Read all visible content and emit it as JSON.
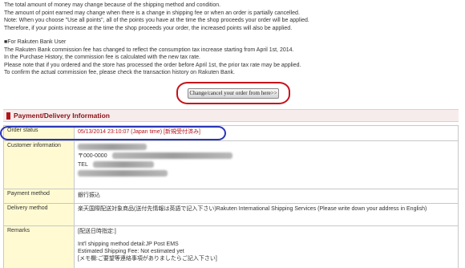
{
  "notices": {
    "line1": "The total amount of money may change because of the shipping method and condition.",
    "line2": "The amount of point earned may change when there is a change in shipping fee or when an order is partially cancelled.",
    "line3": "Note: When you choose \"Use all points\", all of the points you have at the time the shop proceeds your order will be applied.",
    "line4": "Therefore, if your points increase at the time the shop proceeds your order, the increased points will also be applied.",
    "bank_heading": "■For Rakuten Bank User",
    "bank_line1": "The Rakuten Bank commission fee has changed to reflect the consumption tax increase starting from April 1st, 2014.",
    "bank_line2": "In the Purchase History, the commission fee is calculated with the new tax rate.",
    "bank_line3": "Please note that if you ordered and the store has processed the order before April 1st, the prior tax rate may be applied.",
    "bank_line4": "To confirm the actual commission fee, please check the transaction history on Rakuten Bank."
  },
  "change_button_label": "Change/cancel your order from here>>",
  "section": {
    "title": "Payment/Delivery Information"
  },
  "rows": {
    "order_status": {
      "label": "Order status",
      "value": "05/13/2014 23:10:07 (Japan time) [新規受付済み]"
    },
    "customer_information": {
      "label": "Customer information",
      "postal_prefix": "〒000-0000",
      "tel_prefix": "TEL"
    },
    "payment_method": {
      "label": "Payment method",
      "value": "銀行振込"
    },
    "delivery_method": {
      "label": "Delivery method",
      "value": "楽天国際配送対象商品(送付先情報は英語で記入下さい)Rakuten International Shipping Services (Please write down your address in English)"
    },
    "remarks": {
      "label": "Remarks",
      "line1": "[配送日時指定:]",
      "line2": "Int'l shipping method detail:JP Post EMS",
      "line3": "Estimated Shipping Fee: Not estimated yet",
      "line4": "[メモ欄:ご要望等連絡事項がありましたらご記入下さい]"
    }
  },
  "colors": {
    "button_highlight_ring": "#c8101a",
    "status_highlight_ring": "#2a36b8",
    "section_accent": "#b3141c",
    "label_cell_background": "#fffad2",
    "status_text": "#b3141c"
  }
}
